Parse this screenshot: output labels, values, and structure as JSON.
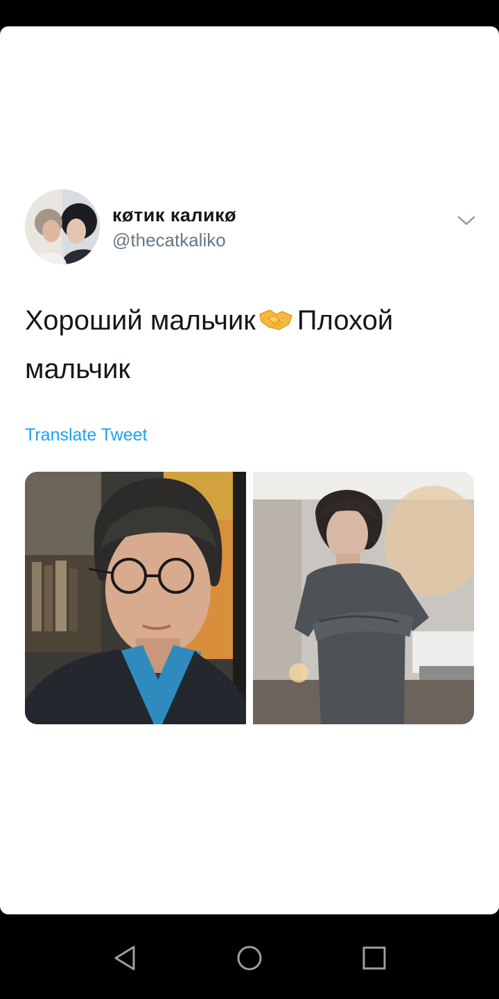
{
  "tweet": {
    "display_name": "кøтик каликø",
    "handle": "@thecatkaliko",
    "text_before_emoji": "Хороший мальчик",
    "emoji": "handshake-emoji",
    "text_after_emoji": "Плохой мальчик",
    "translate_label": "Translate Tweet",
    "media": [
      {
        "icon": "photo-left"
      },
      {
        "icon": "photo-right"
      }
    ]
  },
  "colors": {
    "text": "#14171a",
    "secondary": "#657786",
    "link": "#1da1f2",
    "background": "#ffffff",
    "system_bar": "#000000"
  },
  "navigation": {
    "back": "back-icon",
    "home": "home-icon",
    "recents": "recents-icon"
  }
}
